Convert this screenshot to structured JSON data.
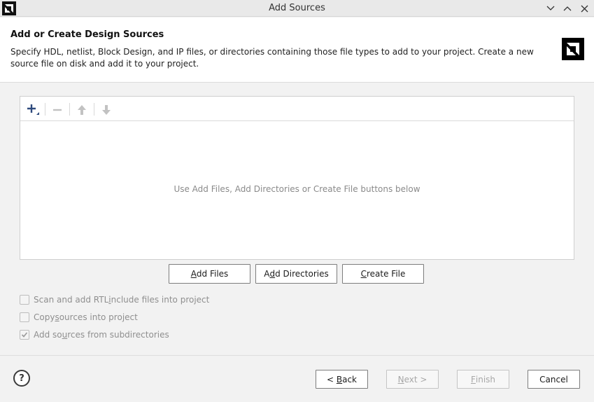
{
  "window": {
    "title": "Add Sources"
  },
  "header": {
    "title": "Add or Create Design Sources",
    "description": "Specify HDL, netlist, Block Design, and IP files, or directories containing those file types to add to your project. Create a new source file on disk and add it to your project."
  },
  "file_panel": {
    "empty_message": "Use Add Files, Add Directories or Create File buttons below",
    "toolbar_icons": [
      "add-icon",
      "remove-icon",
      "move-up-icon",
      "move-down-icon"
    ]
  },
  "actions": {
    "add_files": {
      "pre": "",
      "key": "A",
      "post": "dd Files"
    },
    "add_directories": {
      "pre": "A",
      "key": "d",
      "post": "d Directories"
    },
    "create_file": {
      "pre": "",
      "key": "C",
      "post": "reate File"
    }
  },
  "options": [
    {
      "pre": "Scan and add RTL ",
      "key": "i",
      "post": "nclude files into project",
      "checked": false
    },
    {
      "pre": "Copy ",
      "key": "s",
      "post": "ources into project",
      "checked": false
    },
    {
      "pre": "Add so",
      "key": "u",
      "post": "rces from subdirectories",
      "checked": true
    }
  ],
  "footer": {
    "help": "?",
    "back": {
      "pre": "< ",
      "key": "B",
      "post": "ack"
    },
    "next": {
      "pre": "",
      "key": "N",
      "post": "ext >"
    },
    "finish": {
      "pre": "",
      "key": "F",
      "post": "inish"
    },
    "cancel": "Cancel"
  },
  "colors": {
    "accent": "#2e4a7d",
    "disabled_text": "#a7a7a7"
  }
}
